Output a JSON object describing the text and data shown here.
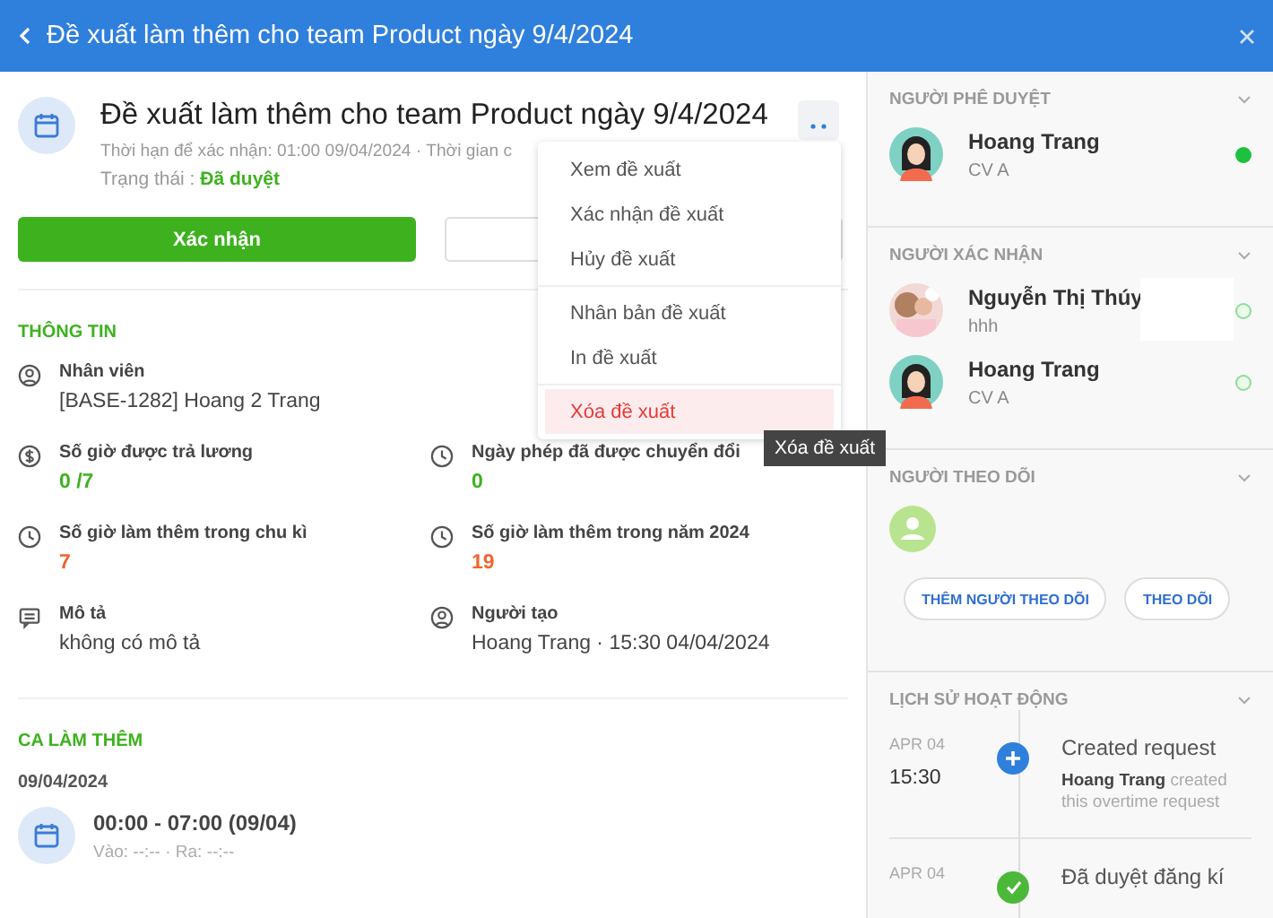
{
  "header": {
    "title": "Đề xuất làm thêm cho team Product ngày 9/4/2024"
  },
  "request": {
    "title": "Đề xuất làm thêm cho team Product ngày 9/4/2024",
    "subtitle": "Thời hạn để xác nhận: 01:00 09/04/2024 · Thời gian c",
    "status_label": "Trạng thái :",
    "status": "Đã duyệt",
    "confirm_button": "Xác nhận"
  },
  "menu": {
    "items": [
      {
        "label": "Xem đề xuất",
        "kind": "normal",
        "selected": false
      },
      {
        "label": "Xác nhận đề xuất",
        "kind": "normal",
        "selected": false
      },
      {
        "label": "Hủy đề xuất",
        "kind": "normal",
        "selected": false
      },
      {
        "label": "Nhân bản đề xuất",
        "kind": "normal",
        "selected": false
      },
      {
        "label": "In đề xuất",
        "kind": "normal",
        "selected": false
      },
      {
        "label": "Xóa đề xuất",
        "kind": "danger",
        "selected": true
      }
    ],
    "tooltip": "Xóa đề xuất"
  },
  "info": {
    "heading": "THÔNG TIN",
    "fields": [
      {
        "label": "Nhân viên",
        "value": "[BASE-1282] Hoang 2 Trang",
        "kind": "user"
      },
      {
        "label": "Số giờ được trả lương",
        "value": "0 /7",
        "kind": "money",
        "color": "#3db21e"
      },
      {
        "label": "Ngày phép đã được chuyển đổi",
        "value": "0",
        "kind": "clock",
        "color": "#3db21e"
      },
      {
        "label": "Số giờ làm thêm trong chu kì",
        "value": "7",
        "kind": "clock",
        "color": "#f0642a"
      },
      {
        "label": "Số giờ làm thêm trong năm 2024",
        "value": "19",
        "kind": "clock",
        "color": "#f0642a"
      },
      {
        "label": "Mô tả",
        "value": "không có mô tả",
        "kind": "comment"
      },
      {
        "label": "Người tạo",
        "value": "Hoang Trang · 15:30 04/04/2024",
        "kind": "user"
      }
    ]
  },
  "shifts": {
    "heading": "CA LÀM THÊM",
    "date": "09/04/2024",
    "time": "00:00 - 07:00 (09/04)",
    "checkinout": "Vào: --:-- · Ra: --:--"
  },
  "approvers": {
    "heading": "NGƯỜI PHÊ DUYỆT",
    "people": [
      {
        "name": "Hoang Trang",
        "role": "CV A",
        "kind": "figure",
        "approved": true
      }
    ]
  },
  "confirmers": {
    "heading": "NGƯỜI XÁC NHẬN",
    "people": [
      {
        "name": "Nguyễn Thị Thúy",
        "role": "hhh",
        "approved": false
      },
      {
        "name": "Hoang Trang",
        "role": "CV A",
        "kind": "figure",
        "approved": false
      }
    ]
  },
  "followers": {
    "heading": "NGƯỜI THEO DÕI",
    "buttons": [
      "THÊM NGƯỜI THEO DÕI",
      "THEO DÕI"
    ]
  },
  "history": {
    "heading": "LỊCH SỬ HOẠT ĐỘNG",
    "events": [
      {
        "date": "APR 04",
        "time": "15:30",
        "title": "Created request",
        "actor": "Hoang Trang",
        "text": "created this overtime request",
        "kind": "create"
      },
      {
        "date": "APR 04",
        "title": "Đã duyệt đăng kí",
        "kind": "approve"
      }
    ]
  }
}
